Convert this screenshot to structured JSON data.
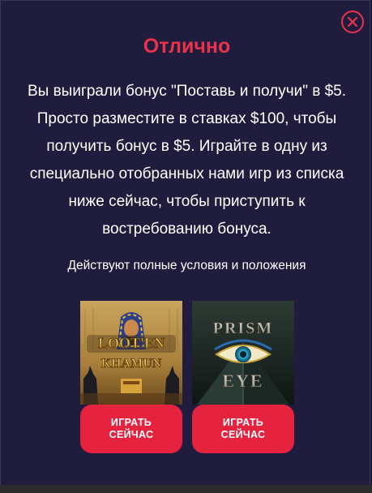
{
  "dialog": {
    "title": "Отлично",
    "message": "Вы выиграли бонус \"Поставь и получи\" в $5. Просто разместите в ставках $100, чтобы получить бонус в $5. Играйте в одну из специально отобранных нами игр из списка ниже сейчас, чтобы приступить к востребованию бонуса.",
    "terms": "Действуют полные условия и положения"
  },
  "games": [
    {
      "logo_text": "Loot'en Khamun",
      "play_label": "ИГРАТЬ СЕЙЧАС"
    },
    {
      "logo_text": "Prism Eye",
      "play_label": "ИГРАТЬ СЕЙЧАС"
    }
  ],
  "colors": {
    "background": "#1f1c3d",
    "accent": "#e8334a",
    "button": "#e6233f",
    "text": "#ffffff"
  },
  "icons": {
    "close": "close-icon"
  }
}
